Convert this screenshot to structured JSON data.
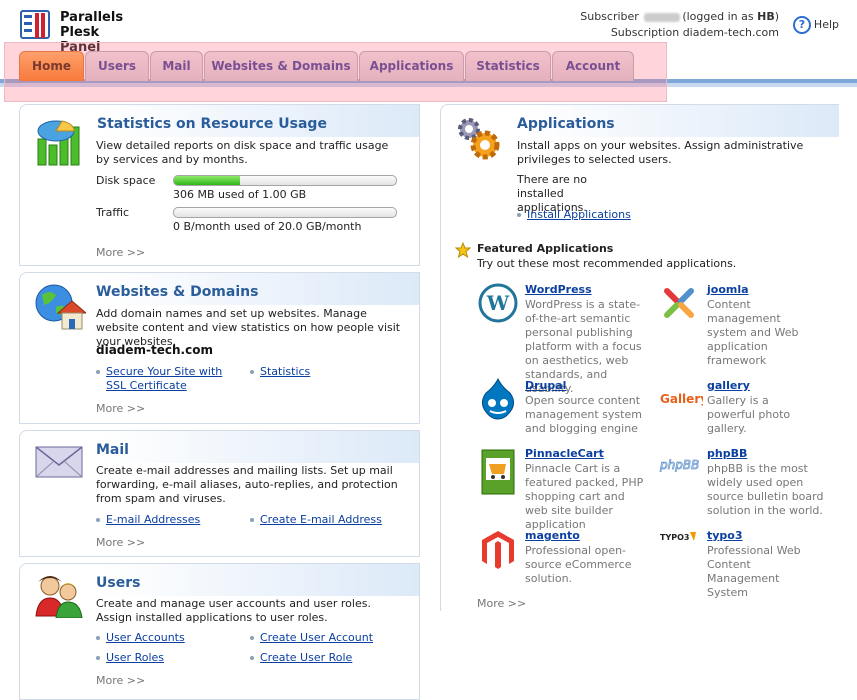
{
  "header": {
    "logo_line1": "Parallels",
    "logo_line2": "Plesk Panel",
    "subscriber_prefix": "Subscriber",
    "logged_in": "(logged in as ",
    "logged_in_user": "HB",
    "logged_in_suffix": ")",
    "subscription_label": "Subscription",
    "subscription_value": "diadem-tech.com",
    "help": "Help"
  },
  "tabs": [
    "Home",
    "Users",
    "Mail",
    "Websites & Domains",
    "Applications",
    "Statistics",
    "Account"
  ],
  "stats": {
    "title": "Statistics on Resource Usage",
    "desc": "View detailed reports on disk space and traffic usage by services and by months.",
    "disk_label": "Disk space",
    "disk_text": "306 MB used of 1.00 GB",
    "disk_fraction": 0.299,
    "traffic_label": "Traffic",
    "traffic_text": "0 B/month used of 20.0 GB/month",
    "traffic_fraction": 0,
    "more": "More >>"
  },
  "websites": {
    "title": "Websites & Domains",
    "desc": "Add domain names and set up websites. Manage website content and view statistics on how people visit your websites.",
    "domain": "diadem-tech.com",
    "link1": "Secure Your Site with SSL Certificate",
    "link2": "Statistics",
    "more": "More >>"
  },
  "mail": {
    "title": "Mail",
    "desc": "Create e-mail addresses and mailing lists. Set up mail forwarding, e-mail aliases, auto-replies, and protection from spam and viruses.",
    "link1": "E-mail Addresses",
    "link2": "Create E-mail Address",
    "more": "More >>"
  },
  "users": {
    "title": "Users",
    "desc": "Create and manage user accounts and user roles. Assign installed applications to user roles.",
    "link1": "User Accounts",
    "link2": "Create User Account",
    "link3": "User Roles",
    "link4": "Create User Role",
    "more": "More >>"
  },
  "applications": {
    "title": "Applications",
    "desc": "Install apps on your websites. Assign administrative privileges to selected users.",
    "none": "There are no installed applications.",
    "install": "Install Applications",
    "featured_title": "Featured Applications",
    "featured_sub": "Try out these most recommended applications.",
    "more": "More >>",
    "apps": [
      {
        "name": "WordPress",
        "desc": "WordPress is a state-of-the-art semantic personal publishing platform with a focus on aesthetics, web standards, and usability.",
        "icon": "wordpress-icon"
      },
      {
        "name": "joomla",
        "desc": "Content management system and Web application framework",
        "icon": "joomla-icon"
      },
      {
        "name": "Drupal",
        "desc": "Open source content management system and blogging engine",
        "icon": "drupal-icon"
      },
      {
        "name": "gallery",
        "desc": "Gallery is a powerful photo gallery.",
        "icon": "gallery-icon",
        "logo_text": "Gallery"
      },
      {
        "name": "PinnacleCart",
        "desc": "Pinnacle Cart is a featured packed, PHP shopping cart and web site builder application",
        "icon": "pinnaclecart-icon"
      },
      {
        "name": "phpBB",
        "desc": "phpBB is the most widely used open source bulletin board solution in the world.",
        "icon": "phpbb-icon",
        "logo_text": "phpBB"
      },
      {
        "name": "magento",
        "desc": "Professional open-source eCommerce solution.",
        "icon": "magento-icon"
      },
      {
        "name": "typo3",
        "desc": "Professional Web Content Management System",
        "icon": "typo3-icon",
        "logo_text": "TYPO3"
      }
    ]
  },
  "colors": {
    "tab_active": "#f47a16",
    "title_blue": "#2a5d9a",
    "link_blue": "#0b3fa0",
    "progress_green": "#2fb71a"
  }
}
